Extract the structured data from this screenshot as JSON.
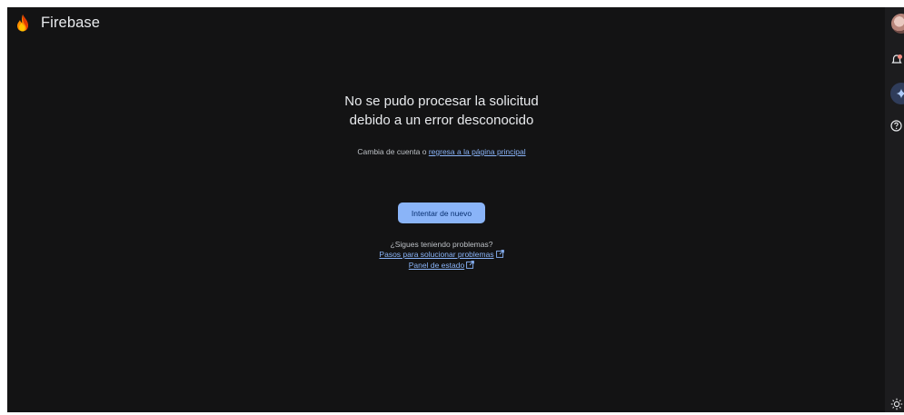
{
  "app": {
    "brand": "Firebase"
  },
  "error": {
    "title": "No se pudo procesar la solicitud\ndebido a un error desconocido",
    "switch_prefix": "Cambia de cuenta o ",
    "home_link": "regresa a la página principal",
    "retry_button": "Intentar de nuevo",
    "still_problems": "¿Sigues teniendo problemas?",
    "troubleshoot_link": "Pasos para solucionar problemas",
    "status_link": "Panel de estado"
  },
  "rail": {
    "icons": [
      "avatar",
      "notifications-icon",
      "gemini-icon",
      "help-icon",
      "theme-icon"
    ]
  },
  "colors": {
    "background": "#131314",
    "accent": "#8ab4f8",
    "text": "#e8eaed",
    "firebase_orange": "#ff8f00"
  }
}
